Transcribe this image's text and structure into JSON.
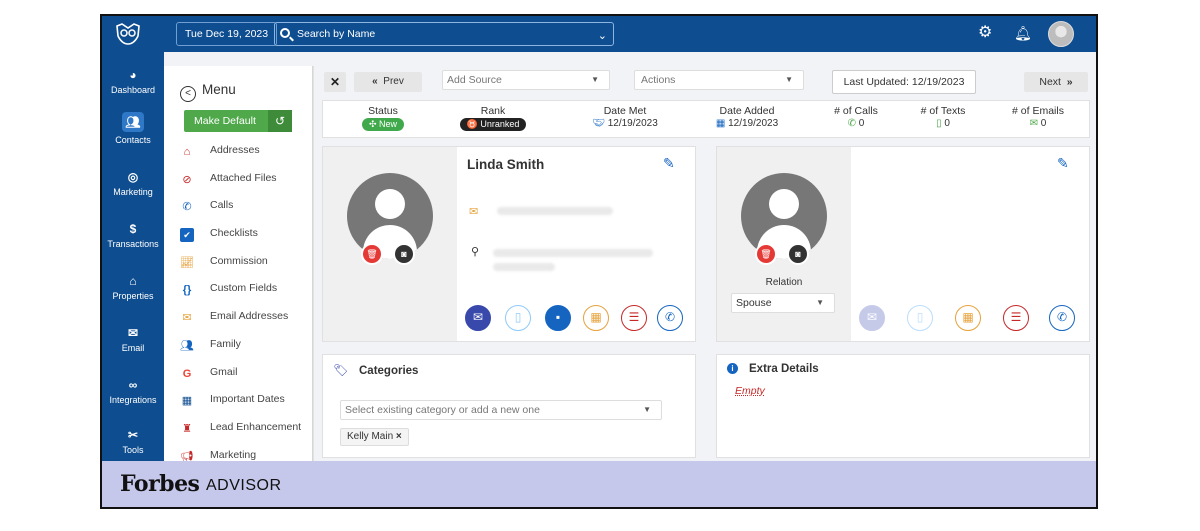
{
  "header": {
    "date": "Tue Dec 19, 2023",
    "search_placeholder": "Search by Name"
  },
  "leftnav": {
    "items": [
      {
        "label": "Dashboard",
        "icon": "dashboard-icon"
      },
      {
        "label": "Contacts",
        "icon": "contacts-icon",
        "active": true
      },
      {
        "label": "Marketing",
        "icon": "marketing-icon"
      },
      {
        "label": "Transactions",
        "icon": "dollar-icon"
      },
      {
        "label": "Properties",
        "icon": "home-icon"
      },
      {
        "label": "Email",
        "icon": "envelope-icon"
      },
      {
        "label": "Integrations",
        "icon": "link-icon"
      },
      {
        "label": "Tools",
        "icon": "tools-icon"
      }
    ]
  },
  "menu": {
    "title": "Menu",
    "make_default": "Make Default",
    "items": [
      {
        "label": "Addresses",
        "icon": "house-icon",
        "color": "#c62828"
      },
      {
        "label": "Attached Files",
        "icon": "paperclip-icon",
        "color": "#c62828"
      },
      {
        "label": "Calls",
        "icon": "phone-icon",
        "color": "#1565c0"
      },
      {
        "label": "Checklists",
        "icon": "checkbox-icon",
        "color": "#1565c0"
      },
      {
        "label": "Commission",
        "icon": "chart-icon",
        "color": "#e6a23c"
      },
      {
        "label": "Custom Fields",
        "icon": "braces-icon",
        "color": "#1565c0"
      },
      {
        "label": "Email Addresses",
        "icon": "envelope-open-icon",
        "color": "#e6a23c"
      },
      {
        "label": "Family",
        "icon": "family-icon",
        "color": "#1565c0"
      },
      {
        "label": "Gmail",
        "icon": "google-icon",
        "color": "#ea4335"
      },
      {
        "label": "Important Dates",
        "icon": "calendar-icon",
        "color": "#0e4d8f"
      },
      {
        "label": "Lead Enhancement",
        "icon": "lead-icon",
        "color": "#c62828"
      },
      {
        "label": "Marketing",
        "icon": "megaphone-icon",
        "color": "#c62828"
      }
    ]
  },
  "toolbar": {
    "close": "✕",
    "prev": "Prev",
    "add_source": "Add Source",
    "actions": "Actions",
    "last_updated": "Last Updated: 12/19/2023",
    "next": "Next"
  },
  "stats": {
    "status_label": "Status",
    "status_value": "New",
    "rank_label": "Rank",
    "rank_value": "Unranked",
    "date_met_label": "Date Met",
    "date_met_value": "12/19/2023",
    "date_added_label": "Date Added",
    "date_added_value": "12/19/2023",
    "calls_label": "# of Calls",
    "calls_value": "0",
    "texts_label": "# of Texts",
    "texts_value": "0",
    "emails_label": "# of Emails",
    "emails_value": "0"
  },
  "contact": {
    "name": "Linda Smith"
  },
  "relation": {
    "label": "Relation",
    "value": "Spouse"
  },
  "categories": {
    "title": "Categories",
    "placeholder": "Select existing category or add a new one",
    "chip": "Kelly Main"
  },
  "extra": {
    "title": "Extra Details",
    "value": "Empty"
  },
  "footer": {
    "brand": "Forbes",
    "sub": "ADVISOR"
  },
  "colors": {
    "brand": "#0e4d8f",
    "green": "#4fa84a",
    "danger": "#e53935"
  }
}
